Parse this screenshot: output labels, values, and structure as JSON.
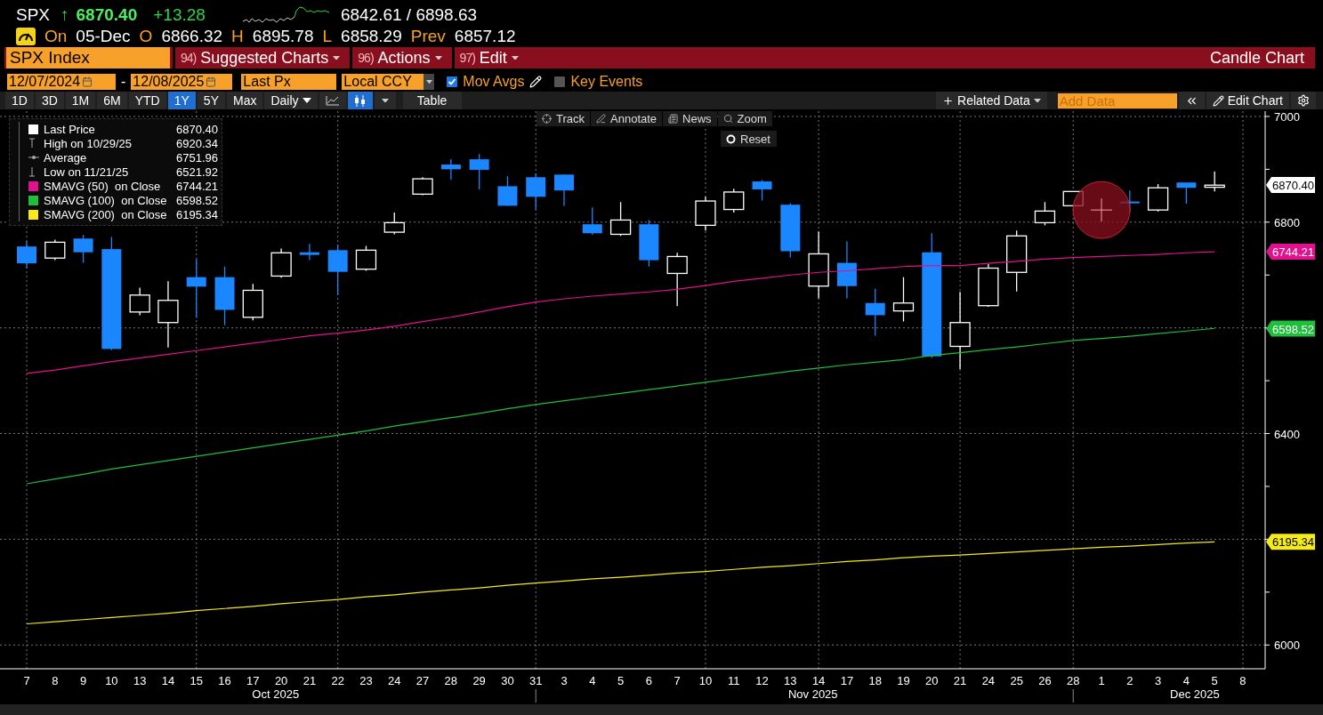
{
  "quote": {
    "ticker": "SPX",
    "arrow": "↑",
    "last": "6870.40",
    "change": "+13.28",
    "range": "6842.61 / 6898.63"
  },
  "session": {
    "on_label": "On",
    "date": "05-Dec",
    "fields": [
      {
        "label": "O",
        "value": "6866.32"
      },
      {
        "label": "H",
        "value": "6895.78"
      },
      {
        "label": "L",
        "value": "6858.29"
      },
      {
        "label": "Prev",
        "value": "6857.12"
      }
    ]
  },
  "menu_bar": {
    "security": "SPX Index",
    "menus": [
      {
        "number": "94)",
        "label": "Suggested Charts"
      },
      {
        "number": "96)",
        "label": "Actions"
      },
      {
        "number": "97)",
        "label": "Edit"
      }
    ],
    "title": "Candle Chart"
  },
  "settings_bar": {
    "start_date": "12/07/2024",
    "separator": "-",
    "end_date": "12/08/2025",
    "field": "Last Px",
    "currency": "Local CCY",
    "options": [
      {
        "label": "Mov Avgs",
        "checked": true,
        "editable": true
      },
      {
        "label": "Key Events",
        "checked": false,
        "editable": false
      }
    ]
  },
  "toolbar": {
    "periods": [
      {
        "label": "1D",
        "selected": false
      },
      {
        "label": "3D",
        "selected": false
      },
      {
        "label": "1M",
        "selected": false
      },
      {
        "label": "6M",
        "selected": false
      },
      {
        "label": "YTD",
        "selected": false
      },
      {
        "label": "1Y",
        "selected": true
      },
      {
        "label": "5Y",
        "selected": false
      },
      {
        "label": "Max",
        "selected": false
      }
    ],
    "frequency": "Daily",
    "chart_types": [
      {
        "kind": "line",
        "selected": false
      },
      {
        "kind": "candle",
        "selected": true
      }
    ],
    "table": "Table",
    "related": "Related Data",
    "add_data_placeholder": "Add Data",
    "edit_chart": "Edit Chart"
  },
  "chart_tools": [
    {
      "kind": "track",
      "label": "Track"
    },
    {
      "kind": "annotate",
      "label": "Annotate"
    },
    {
      "kind": "news",
      "label": "News"
    },
    {
      "kind": "zoom",
      "label": "Zoom"
    }
  ],
  "reset": "Reset",
  "legend": [
    {
      "kind": "swatch",
      "color": "#ffffff",
      "label": "Last Price",
      "value": "6870.40"
    },
    {
      "kind": "high",
      "label": "High on 10/29/25",
      "value": "6920.34"
    },
    {
      "kind": "average",
      "label": "Average",
      "value": "6751.96"
    },
    {
      "kind": "low",
      "label": "Low on 11/21/25",
      "value": "6521.92"
    },
    {
      "kind": "series",
      "value": "6744.21"
    },
    {
      "kind": "series",
      "value": "6598.52"
    },
    {
      "kind": "series",
      "value": "6195.34"
    }
  ],
  "price_tags": [
    {
      "label": "6870.40",
      "color": "#ffffff"
    },
    {
      "label": "6744.21",
      "color": "#e3118f"
    },
    {
      "label": "6598.52",
      "color": "#1fbf3c"
    },
    {
      "label": "6195.34",
      "color": "#f4ea1c"
    }
  ],
  "chart_data": {
    "type": "line",
    "grid": true,
    "categories": [
      "7",
      "8",
      "9",
      "10",
      "13",
      "14",
      "15",
      "16",
      "17",
      "20",
      "21",
      "22",
      "23",
      "24",
      "27",
      "28",
      "29",
      "30",
      "31",
      "3",
      "4",
      "5",
      "6",
      "7",
      "10",
      "11",
      "12",
      "13",
      "14",
      "17",
      "18",
      "19",
      "20",
      "21",
      "24",
      "25",
      "26",
      "28",
      "1",
      "2",
      "3",
      "4",
      "5",
      "8"
    ],
    "ylim": [
      5955,
      7010
    ],
    "yticks": [
      {
        "value": 6000,
        "label": "6000"
      },
      {
        "value": 6400,
        "label": "6400"
      },
      {
        "value": 6800,
        "label": "6800"
      },
      {
        "value": 7000,
        "label": "7000"
      }
    ],
    "series": [
      {
        "name": "SMAVG (50)  on Close",
        "color": "#e3118f",
        "values": [
          6514,
          6520,
          6528,
          6536,
          6543,
          6550,
          6557,
          6564,
          6571,
          6578,
          6585,
          6590,
          6596,
          6603,
          6612,
          6620,
          6630,
          6640,
          6649,
          6655,
          6660,
          6664,
          6668,
          6673,
          6680,
          6688,
          6694,
          6700,
          6705,
          6708,
          6712,
          6716,
          6718,
          6718,
          6722,
          6726,
          6730,
          6733,
          6735,
          6737,
          6739,
          6742,
          6744,
          null
        ]
      },
      {
        "name": "SMAVG (100)  on Close",
        "color": "#1fbf3c",
        "values": [
          6305,
          6314,
          6323,
          6333,
          6341,
          6349,
          6357,
          6365,
          6373,
          6381,
          6389,
          6397,
          6405,
          6414,
          6422,
          6430,
          6438,
          6447,
          6455,
          6462,
          6469,
          6476,
          6483,
          6490,
          6497,
          6504,
          6511,
          6518,
          6524,
          6530,
          6535,
          6540,
          6548,
          6553,
          6559,
          6564,
          6570,
          6576,
          6580,
          6584,
          6589,
          6594,
          6599,
          null
        ]
      },
      {
        "name": "SMAVG (200)  on Close",
        "color": "#f4ea1c",
        "values": [
          6040,
          6044,
          6048,
          6052,
          6056,
          6060,
          6065,
          6069,
          6073,
          6078,
          6082,
          6086,
          6091,
          6095,
          6100,
          6104,
          6108,
          6113,
          6117,
          6121,
          6125,
          6128,
          6132,
          6136,
          6139,
          6143,
          6147,
          6150,
          6154,
          6158,
          6161,
          6165,
          6168,
          6170,
          6173,
          6176,
          6179,
          6182,
          6185,
          6187,
          6190,
          6193,
          6195,
          null
        ]
      }
    ],
    "annotations": [
      "Oct 2025",
      "Nov 2025",
      "Dec 2025"
    ]
  }
}
